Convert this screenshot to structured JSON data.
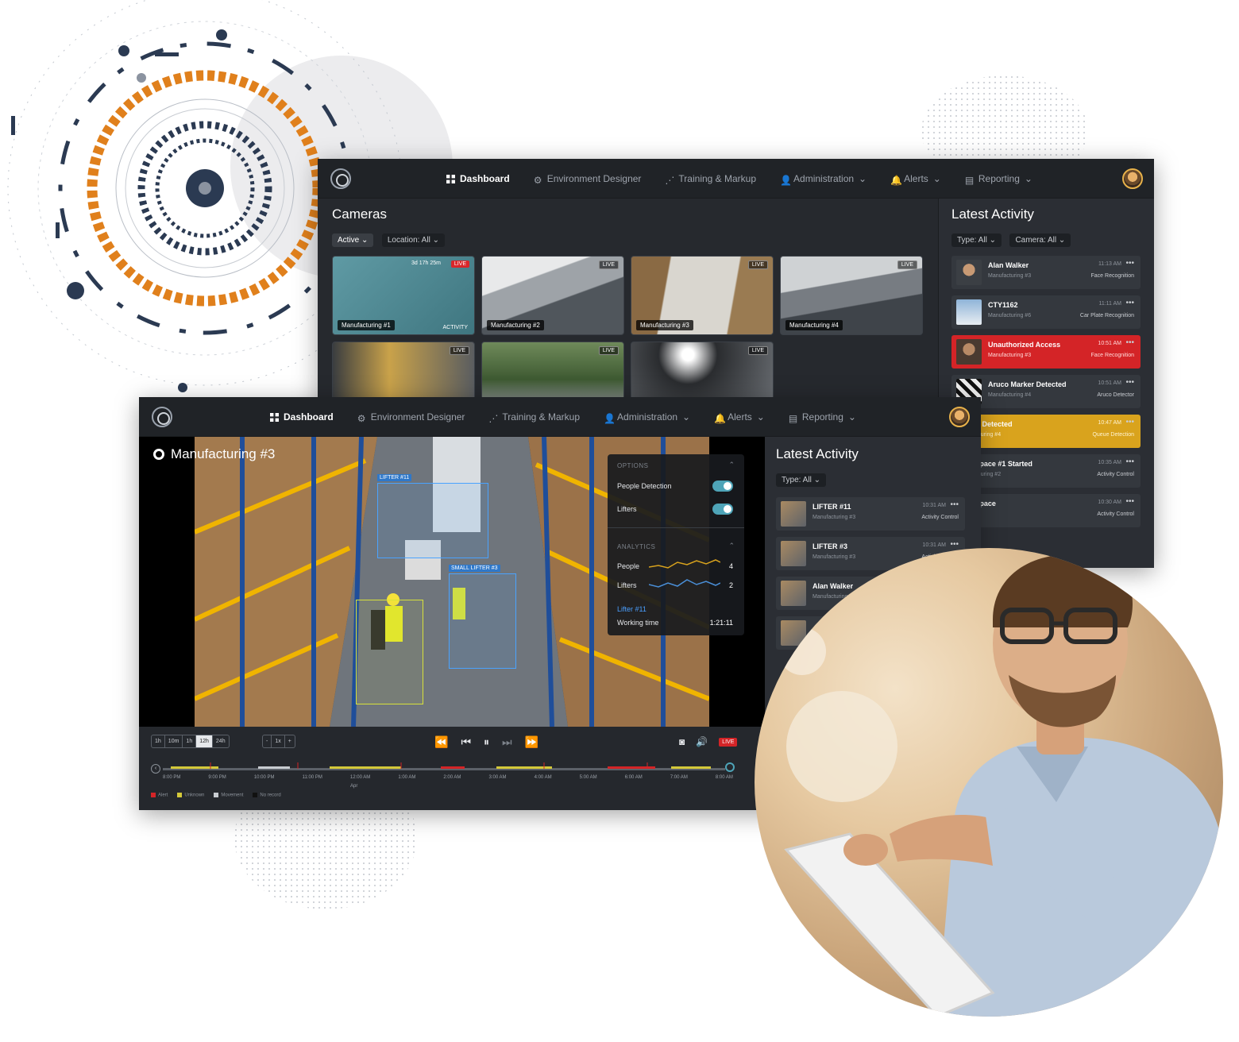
{
  "back_window": {
    "nav": {
      "dashboard": "Dashboard",
      "environment_designer": "Environment Designer",
      "training_markup": "Training & Markup",
      "administration": "Administration",
      "alerts": "Alerts",
      "reporting": "Reporting"
    },
    "cameras": {
      "title": "Cameras",
      "filter_active": "Active",
      "filter_location": "Location: All",
      "tiles": [
        {
          "label": "Manufacturing #1",
          "timer": "3d 17h 25m",
          "live": "LIVE",
          "activity": "ACTIVITY"
        },
        {
          "label": "Manufacturing #2",
          "live": "LIVE"
        },
        {
          "label": "Manufacturing #3",
          "live": "LIVE"
        },
        {
          "label": "Manufacturing #4",
          "live": "LIVE"
        },
        {
          "label": "",
          "live": "LIVE"
        },
        {
          "label": "",
          "live": "LIVE"
        },
        {
          "label": "",
          "live": "LIVE"
        }
      ]
    },
    "latest_activity": {
      "title": "Latest Activity",
      "filter_type": "Type: All",
      "filter_camera": "Camera: All",
      "items": [
        {
          "name": "Alan Walker",
          "camera": "Manufacturing #3",
          "time": "11:13 AM",
          "type": "Face Recognition",
          "style": "normal"
        },
        {
          "name": "CTY1162",
          "camera": "Manufacturing #6",
          "time": "11:11 AM",
          "type": "Car Plate Recognition",
          "style": "normal"
        },
        {
          "name": "Unauthorized Access",
          "camera": "Manufacturing #3",
          "time": "10:51 AM",
          "type": "Face Recognition",
          "style": "red"
        },
        {
          "name": "Aruco Marker Detected",
          "camera": "Manufacturing #4",
          "time": "10:51 AM",
          "type": "Aruco Detector",
          "style": "normal"
        },
        {
          "name": "Queue Detected",
          "camera": "Manufacturing #4",
          "time": "10:47 AM",
          "type": "Queue Detection",
          "style": "yellow"
        },
        {
          "name": "Workspace #1 Started",
          "camera": "Manufacturing #2",
          "time": "10:35 AM",
          "type": "Activity Control",
          "style": "normal"
        },
        {
          "name": "Workspace",
          "camera": "",
          "time": "10:30 AM",
          "type": "Activity Control",
          "style": "normal"
        }
      ]
    }
  },
  "front_window": {
    "nav": {
      "dashboard": "Dashboard",
      "environment_designer": "Environment Designer",
      "training_markup": "Training & Markup",
      "administration": "Administration",
      "alerts": "Alerts",
      "reporting": "Reporting"
    },
    "video": {
      "title": "Manufacturing #3",
      "detections": [
        "LIFTER #11",
        "SMALL LIFTER #3"
      ],
      "options": {
        "header": "OPTIONS",
        "people_detection": "People Detection",
        "lifters": "Lifters"
      },
      "analytics": {
        "header": "ANALYTICS",
        "people_label": "People",
        "people_value": "4",
        "lifters_label": "Lifters",
        "lifters_value": "2",
        "lifter_name": "Lifter #11",
        "working_time_label": "Working time",
        "working_time_value": "1:21:11"
      }
    },
    "controls": {
      "ranges": [
        "1h",
        "10m",
        "1h",
        "12h",
        "24h"
      ],
      "active_range": "12h",
      "speed": [
        "-",
        "1x",
        "+"
      ],
      "live": "LIVE",
      "ticks": [
        "8:00 PM",
        "9:00 PM",
        "10:00 PM",
        "11:00 PM",
        "12:00 AM",
        "1:00 AM",
        "2:00 AM",
        "3:00 AM",
        "4:00 AM",
        "5:00 AM",
        "6:00 AM",
        "7:00 AM",
        "8:00 AM"
      ],
      "date_label": "Apr",
      "legend": [
        "Alert",
        "Unknown",
        "Movement",
        "No record"
      ]
    },
    "latest_activity": {
      "title": "Latest Activity",
      "filter_type": "Type: All",
      "items": [
        {
          "name": "LIFTER #11",
          "camera": "Manufacturing #3",
          "time": "10:31 AM",
          "type": "Activity Control"
        },
        {
          "name": "LIFTER #3",
          "camera": "Manufacturing #3",
          "time": "10:31 AM",
          "type": "Activity Control"
        },
        {
          "name": "Alan Walker",
          "camera": "Manufacturing #3",
          "time": "",
          "type": ""
        }
      ]
    }
  },
  "colors": {
    "accent_red": "#d42427",
    "accent_yellow": "#d9a31d",
    "toggle_teal": "#4ea4b8",
    "deco_orange": "#e0801c",
    "deco_navy": "#2b3a52"
  }
}
